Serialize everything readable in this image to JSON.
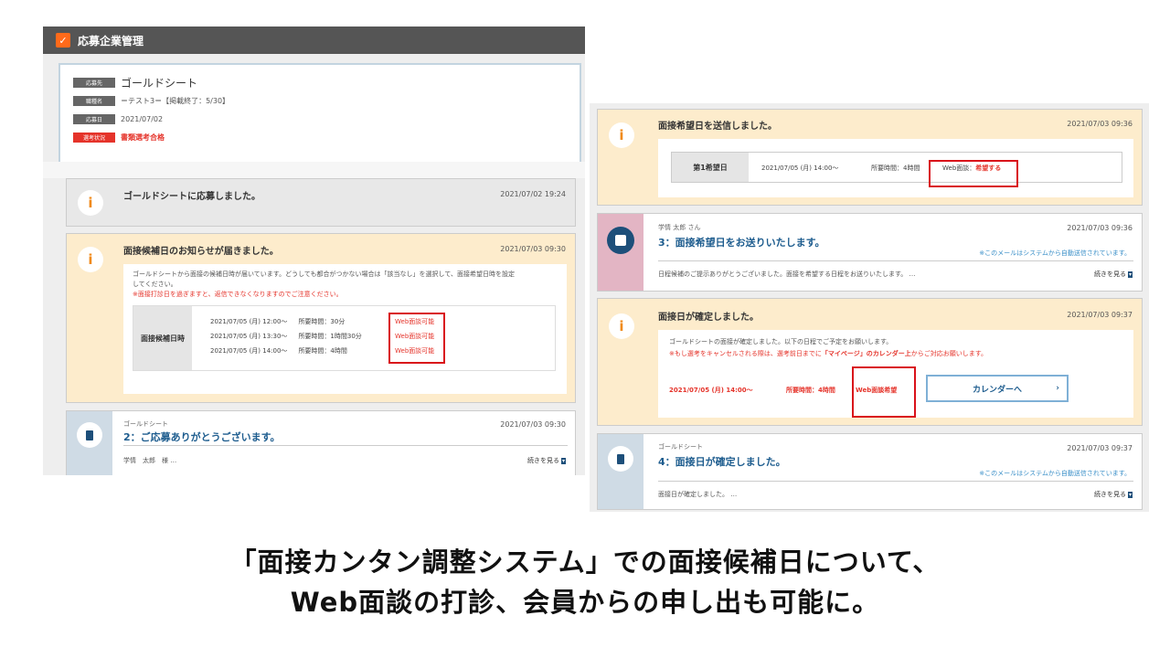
{
  "left": {
    "header_title": "応募企業管理",
    "apply": {
      "rows": [
        {
          "tag": "応募先",
          "value": "ゴールドシート"
        },
        {
          "tag": "職種名",
          "value": "＝テスト3＝【掲載終了：5/30】"
        },
        {
          "tag": "応募日",
          "value": "2021/07/02"
        },
        {
          "tag": "選考状況",
          "value": "書類選考合格"
        }
      ]
    },
    "card1": {
      "title": "ゴールドシートに応募しました。",
      "date": "2021/07/02 19:24"
    },
    "card2": {
      "title": "面接候補日のお知らせが届きました。",
      "date": "2021/07/03 09:30",
      "body1": "ゴールドシートから面接の候補日時が届いています。どうしても都合がつかない場合は「該当なし」を選択して、面接希望日時を設定",
      "body2": "してください。",
      "warn": "※面接打診日を過ぎますと、返信できなくなりますのでご注意ください。",
      "sched_label": "面接候補日時",
      "slots": [
        {
          "time": "2021/07/05 (月) 12:00〜",
          "dur": "所要時間：30分",
          "web": "Web面談可能"
        },
        {
          "time": "2021/07/05 (月) 13:30〜",
          "dur": "所要時間：1時間30分",
          "web": "Web面談可能"
        },
        {
          "time": "2021/07/05 (月) 14:00〜",
          "dur": "所要時間：4時間",
          "web": "Web面談可能"
        }
      ]
    },
    "card3": {
      "sender": "ゴールドシート",
      "date": "2021/07/03 09:30",
      "title": "2：ご応募ありがとうございます。",
      "preview": "学情　太郎　様 …",
      "more": "続きを見る"
    }
  },
  "right": {
    "card1": {
      "title": "面接希望日を送信しました。",
      "date": "2021/07/03 09:36",
      "wish_label": "第1希望日",
      "wish_time": "2021/07/05 (月) 14:00〜",
      "wish_dur": "所要時間：4時間",
      "wish_web_prefix": "Web面談：",
      "wish_web_value": "希望する"
    },
    "card2": {
      "sender": "学情 太郎 さん",
      "date": "2021/07/03 09:36",
      "title": "3：面接希望日をお送りいたします。",
      "auto_note": "※このメールはシステムから自動送信されています。",
      "preview": "日程候補のご提示ありがとうございました。面接を希望する日程をお送りいたします。 …",
      "more": "続きを見る"
    },
    "card3": {
      "title": "面接日が確定しました。",
      "date": "2021/07/03 09:37",
      "body": "ゴールドシートの面接が確定しました。以下の日程でご予定をお願いします。",
      "warn_a": "※もし選考をキャンセルされる際は、選考前日までに",
      "warn_b": "「マイページ」のカレンダー上",
      "warn_c": "からご対応お願いします。",
      "confirm_time": "2021/07/05 (月) 14:00〜",
      "confirm_dur": "所要時間：4時間",
      "confirm_web": "Web面談希望",
      "calendar_button": "カレンダーへ"
    },
    "card4": {
      "sender": "ゴールドシート",
      "date": "2021/07/03 09:37",
      "title": "4：面接日が確定しました。",
      "auto_note": "※このメールはシステムから自動送信されています。",
      "preview": "面接日が確定しました。 …",
      "more": "続きを見る"
    }
  },
  "caption": {
    "line1": "「面接カンタン調整システム」での面接候補日について、",
    "line2": "Web面談の打診、会員からの申し出も可能に。"
  },
  "colors": {
    "accent_red": "#d9111a",
    "brand_orange": "#ff6a1a",
    "navy": "#1d4f7a",
    "beige": "#fdeccc"
  }
}
